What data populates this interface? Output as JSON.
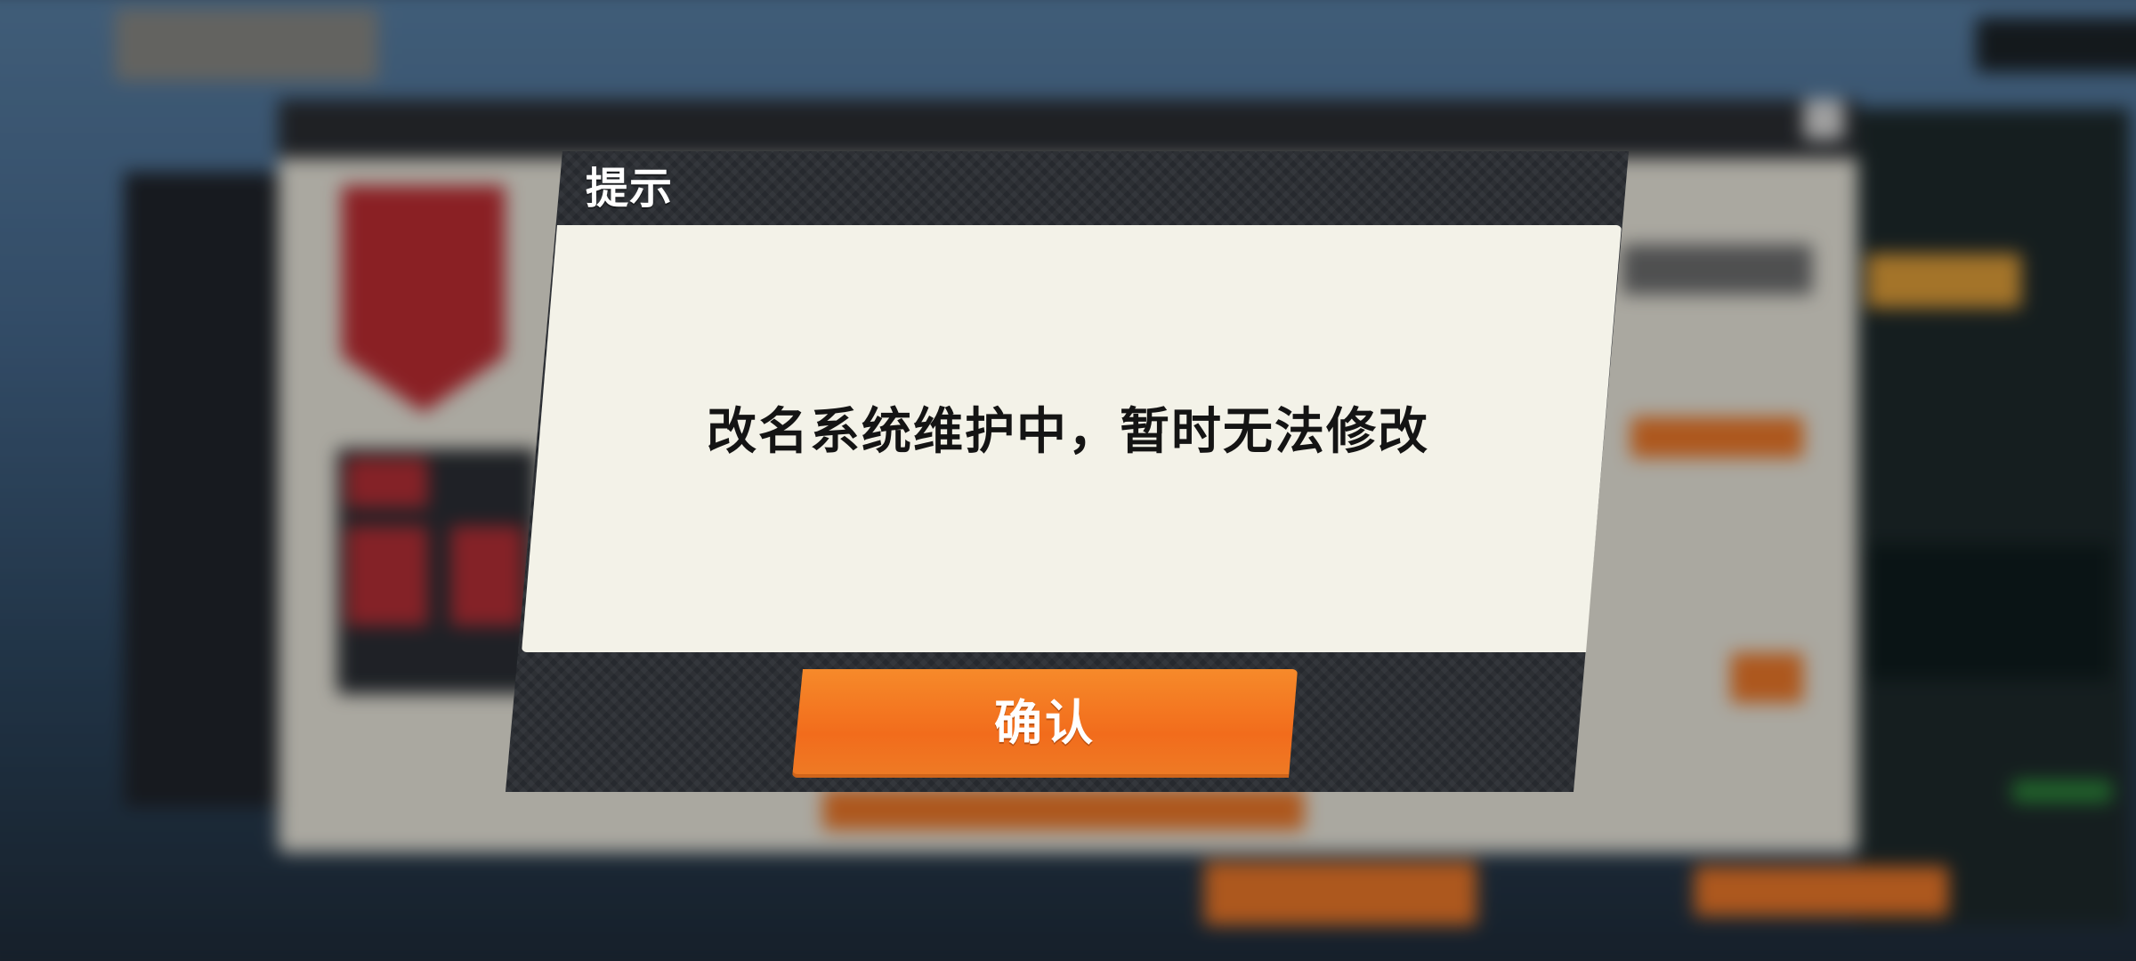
{
  "dialog": {
    "title": "提示",
    "message": "改名系统维护中，暂时无法修改",
    "confirm_label": "确认"
  },
  "colors": {
    "accent": "#f26c1c",
    "dialog_frame": "#26292e",
    "dialog_body": "#f3f2e8",
    "message_text": "#141414"
  },
  "icons": {
    "background_close": "close-icon"
  }
}
